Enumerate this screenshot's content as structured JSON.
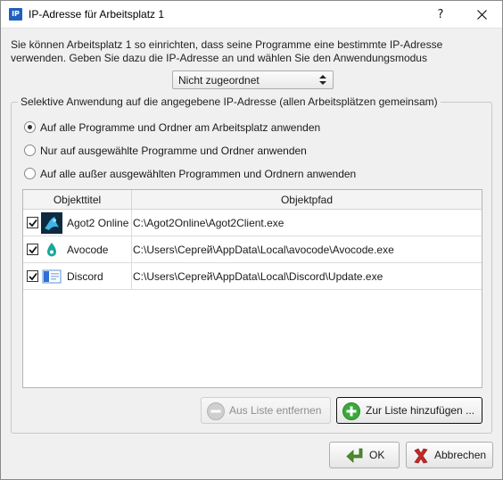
{
  "window": {
    "app_icon_text": "IP",
    "title": "IP-Adresse für Arbeitsplatz 1",
    "help_label": "?"
  },
  "intro": {
    "line1": "Sie können Arbeitsplatz 1 so einrichten, dass seine Programme eine bestimmte IP-Adresse",
    "line2": "verwenden. Geben Sie dazu die IP-Adresse an und wählen Sie den Anwendungsmodus"
  },
  "ip_select": {
    "selected": "Nicht zugeordnet"
  },
  "group": {
    "legend": "Selektive Anwendung auf die angegebene IP-Adresse (allen Arbeitsplätzen gemeinsam)",
    "options": [
      {
        "label": "Auf alle Programme und Ordner am Arbeitsplatz anwenden",
        "checked": true
      },
      {
        "label": "Nur auf ausgewählte Programme und Ordner anwenden",
        "checked": false
      },
      {
        "label": "Auf alle außer ausgewählten Programmen und Ordnern anwenden",
        "checked": false
      }
    ]
  },
  "table": {
    "columns": [
      "Objekttitel",
      "Objektpfad"
    ],
    "rows": [
      {
        "checked": true,
        "icon": "agot2-icon",
        "title": "Agot2 Online",
        "path": "C:\\Agot2Online\\Agot2Client.exe"
      },
      {
        "checked": true,
        "icon": "avocode-icon",
        "title": "Avocode",
        "path": "C:\\Users\\Сергей\\AppData\\Local\\avocode\\Avocode.exe"
      },
      {
        "checked": true,
        "icon": "discord-icon",
        "title": "Discord",
        "path": "C:\\Users\\Сергей\\AppData\\Local\\Discord\\Update.exe"
      }
    ]
  },
  "buttons": {
    "remove_label": "Aus Liste entfernen",
    "add_label": "Zur Liste hinzufügen ...",
    "ok_label": "OK",
    "cancel_label": "Abbrechen"
  },
  "colors": {
    "add_icon": "#3aa93a",
    "ok_icon": "#4f8a2e",
    "cancel_icon": "#c62828",
    "agot2_icon_bg": "#0e2a3f",
    "avocode_icon": "#1aa89a",
    "discord_icon": "#2f6fd6"
  }
}
